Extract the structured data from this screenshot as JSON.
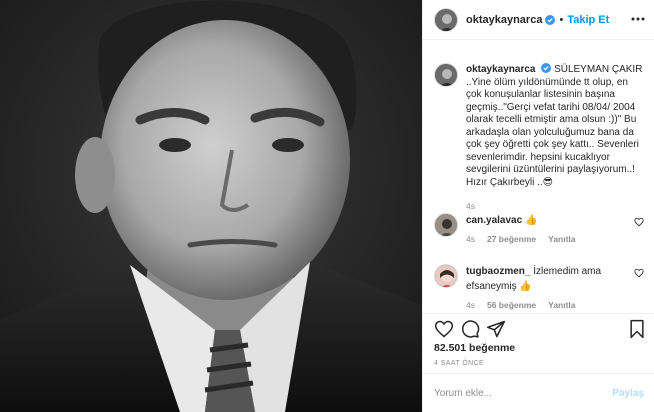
{
  "post": {
    "username": "oktaykaynarca",
    "follow_label": "Takip Et",
    "separator": "•",
    "caption": {
      "username": "oktaykaynarca",
      "text": "SÜLEYMAN ÇAKIR ..Yine ölüm yıldönümünde tt olup, en çok konuşulanlar listesinin başına geçmiş..\"Gerçi vefat tarihi 08/04/ 2004 olarak tecelli etmiştir ama olsun :))\" Bu arkadaşla olan yolculuğumuz bana da çok şey öğretti çok şey kattı.. Sevenleri sevenlerimdir. hepsini kucaklıyor sevgilerini üzüntülerini paylaşıyorum..! Hızır Çakırbeyli ..😎",
      "time": "4s"
    },
    "comments": [
      {
        "username": "can.yalavac",
        "text": "👍",
        "time": "4s",
        "likes": "27 beğenme",
        "reply": "Yanıtla"
      },
      {
        "username": "tugbaozmen_",
        "text": "İzlemedim ama efsaneymiş 👍",
        "time": "4s",
        "likes": "56 beğenme",
        "reply": "Yanıtla"
      }
    ],
    "likes_count": "82.501 beğenme",
    "timestamp": "4 SAAT ÖNCE",
    "add_comment_placeholder": "Yorum ekle...",
    "post_button": "Paylaş"
  },
  "icons": {
    "verified": "verified-badge-icon",
    "more": "more-options-icon",
    "like": "heart-icon",
    "comment": "comment-icon",
    "share": "share-icon",
    "save": "bookmark-icon"
  },
  "colors": {
    "accent": "#0095f6",
    "verified": "#3897f0",
    "muted": "#8e8e8e",
    "text": "#262626",
    "post_disabled": "#b2dffc"
  }
}
